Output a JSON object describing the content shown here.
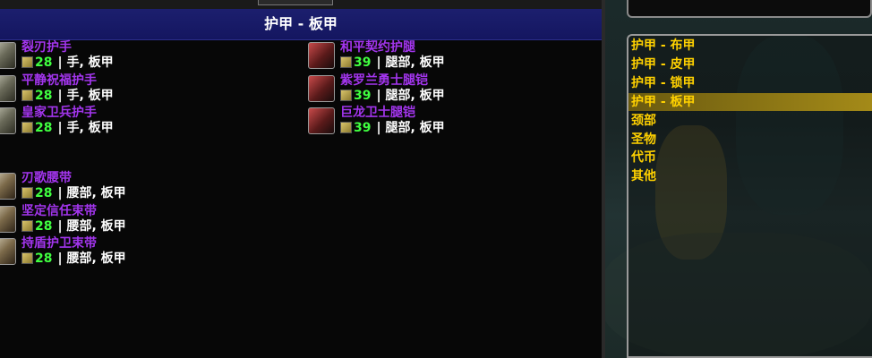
{
  "window": {
    "title": "护甲 - 板甲"
  },
  "colors": {
    "item_name": "#a335ee",
    "level": "#40ff40",
    "category": "#ffd100",
    "title_bar": "#1c1f6e"
  },
  "items": [
    {
      "name": "裂刃护手",
      "level": "28",
      "slot": "| 手, 板甲",
      "icon": "plate-gauntlet-icon",
      "col": 0,
      "row": 0
    },
    {
      "name": "平静祝福护手",
      "level": "28",
      "slot": "| 手, 板甲",
      "icon": "plate-gauntlet-icon",
      "col": 0,
      "row": 1
    },
    {
      "name": "皇家卫兵护手",
      "level": "28",
      "slot": "| 手, 板甲",
      "icon": "plate-gauntlet-icon",
      "col": 0,
      "row": 2
    },
    {
      "name": "刃歌腰带",
      "level": "28",
      "slot": "| 腰部, 板甲",
      "icon": "plate-belt-icon",
      "col": 0,
      "row": 4
    },
    {
      "name": "坚定信任束带",
      "level": "28",
      "slot": "| 腰部, 板甲",
      "icon": "plate-belt-icon",
      "col": 0,
      "row": 5
    },
    {
      "name": "持盾护卫束带",
      "level": "28",
      "slot": "| 腰部, 板甲",
      "icon": "plate-belt-icon",
      "col": 0,
      "row": 6
    },
    {
      "name": "和平契约护腿",
      "level": "39",
      "slot": "| 腿部, 板甲",
      "icon": "plate-legs-icon",
      "col": 1,
      "row": 0
    },
    {
      "name": "紫罗兰勇士腿铠",
      "level": "39",
      "slot": "| 腿部, 板甲",
      "icon": "plate-legs-icon",
      "col": 1,
      "row": 1
    },
    {
      "name": "巨龙卫士腿铠",
      "level": "39",
      "slot": "| 腿部, 板甲",
      "icon": "plate-legs-icon",
      "col": 1,
      "row": 2
    }
  ],
  "categories": [
    {
      "label": "护甲 - 布甲",
      "active": false
    },
    {
      "label": "护甲 - 皮甲",
      "active": false
    },
    {
      "label": "护甲 - 锁甲",
      "active": false
    },
    {
      "label": "护甲 - 板甲",
      "active": true
    },
    {
      "label": "颈部",
      "active": false
    },
    {
      "label": "圣物",
      "active": false
    },
    {
      "label": "代币",
      "active": false
    },
    {
      "label": "其他",
      "active": false
    }
  ]
}
